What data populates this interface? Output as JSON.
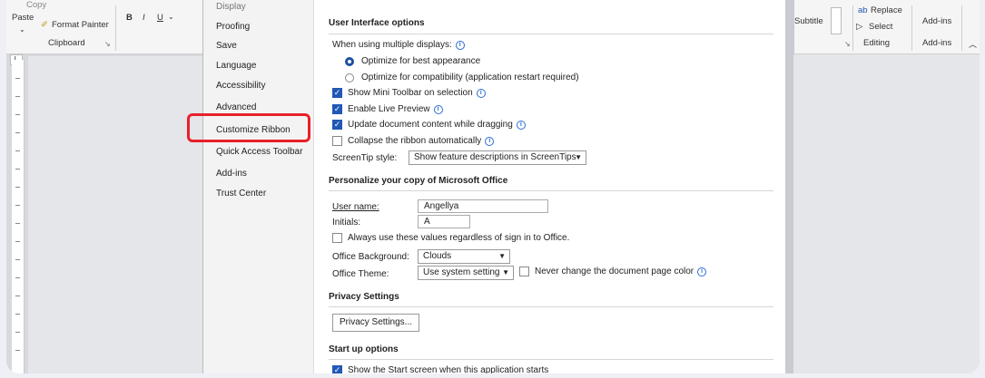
{
  "ribbon": {
    "copy": "Copy",
    "paste": "Paste",
    "format_painter": "Format Painter",
    "clipboard": "Clipboard",
    "bold": "B",
    "italic": "I",
    "underline": "U",
    "subtitle": "Subtitle",
    "replace": "Replace",
    "select": "Select",
    "editing": "Editing",
    "addins_btn": "Add-ins",
    "addins_group": "Add-ins"
  },
  "nav": {
    "items": [
      "Display",
      "Proofing",
      "Save",
      "Language",
      "Accessibility",
      "Advanced",
      "Customize Ribbon",
      "Quick Access Toolbar",
      "Add-ins",
      "Trust Center"
    ]
  },
  "ui_options": {
    "heading": "User Interface options",
    "multi_display_label": "When using multiple displays:",
    "radio_best": "Optimize for best appearance",
    "radio_compat": "Optimize for compatibility (application restart required)",
    "mini_toolbar": "Show Mini Toolbar on selection",
    "live_preview": "Enable Live Preview",
    "update_drag": "Update document content while dragging",
    "collapse_ribbon": "Collapse the ribbon automatically",
    "screentip_label": "ScreenTip style:",
    "screentip_value": "Show feature descriptions in ScreenTips"
  },
  "personalize": {
    "heading": "Personalize your copy of Microsoft Office",
    "username_label": "User name:",
    "username_value": "Angellya",
    "initials_label": "Initials:",
    "initials_value": "A",
    "always_use": "Always use these values regardless of sign in to Office.",
    "background_label": "Office Background:",
    "background_value": "Clouds",
    "theme_label": "Office Theme:",
    "theme_value": "Use system setting",
    "never_change": "Never change the document page color"
  },
  "privacy": {
    "heading": "Privacy Settings",
    "button": "Privacy Settings..."
  },
  "startup": {
    "heading": "Start up options",
    "show_start": "Show the Start screen when this application starts"
  },
  "colors": {
    "accent": "#2258b5",
    "highlight": "#e8202a"
  }
}
